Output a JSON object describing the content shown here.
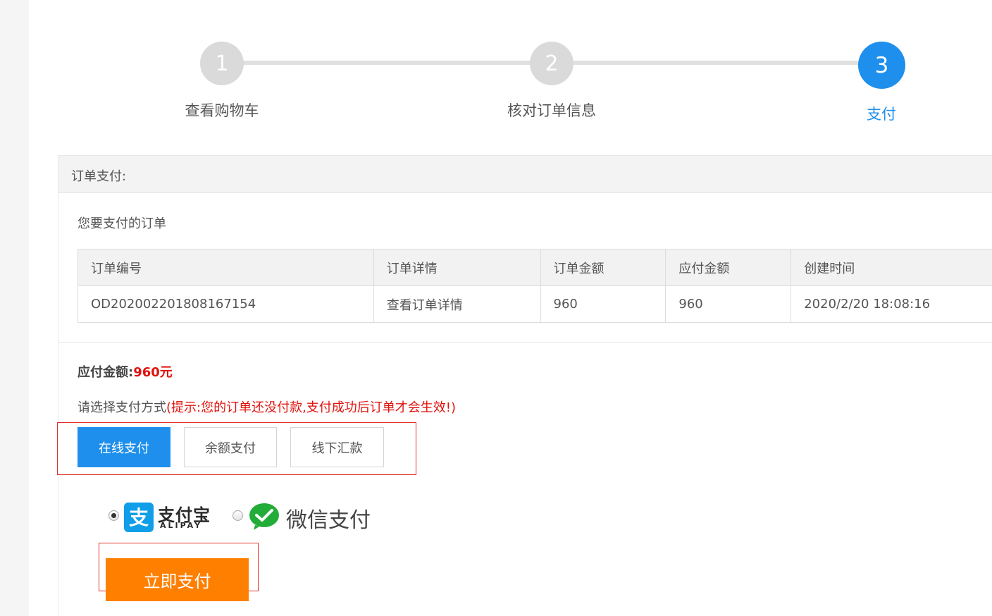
{
  "steps": [
    {
      "number": "1",
      "label": "查看购物车",
      "state": "done"
    },
    {
      "number": "2",
      "label": "核对订单信息",
      "state": "done"
    },
    {
      "number": "3",
      "label": "支付",
      "state": "active"
    }
  ],
  "panel": {
    "title": "订单支付:",
    "subtitle": "您要支付的订单"
  },
  "orders_table": {
    "headers": [
      "订单编号",
      "订单详情",
      "订单金额",
      "应付金额",
      "创建时间"
    ],
    "rows": [
      [
        "OD202002201808167154",
        "查看订单详情",
        "960",
        "960",
        "2020/2/20 18:08:16"
      ]
    ]
  },
  "amount_due": {
    "label": "应付金额:",
    "value": "960元"
  },
  "payment_method": {
    "prompt": "请选择支付方式",
    "tip": "(提示:您的订单还没付款,支付成功后订单才会生效!)",
    "tabs": [
      {
        "label": "在线支付",
        "active": true
      },
      {
        "label": "余额支付",
        "active": false
      },
      {
        "label": "线下汇款",
        "active": false
      }
    ]
  },
  "channels": {
    "alipay": {
      "cn": "支付宝",
      "en": "ALIPAY",
      "logo_glyph": "支",
      "selected": true
    },
    "wechat": {
      "label": "微信支付",
      "selected": false
    }
  },
  "pay_button": {
    "label": "立即支付"
  },
  "colors": {
    "accent_blue": "#1e8fec",
    "alert_red": "#e0140e",
    "pay_orange": "#ff7f00",
    "outline_red": "#e0312a",
    "wechat_green": "#22ac38",
    "alipay_blue": "#109ee9"
  },
  "icons": [
    "alipay-logo-icon",
    "wechat-logo-icon",
    "radio-icon"
  ]
}
